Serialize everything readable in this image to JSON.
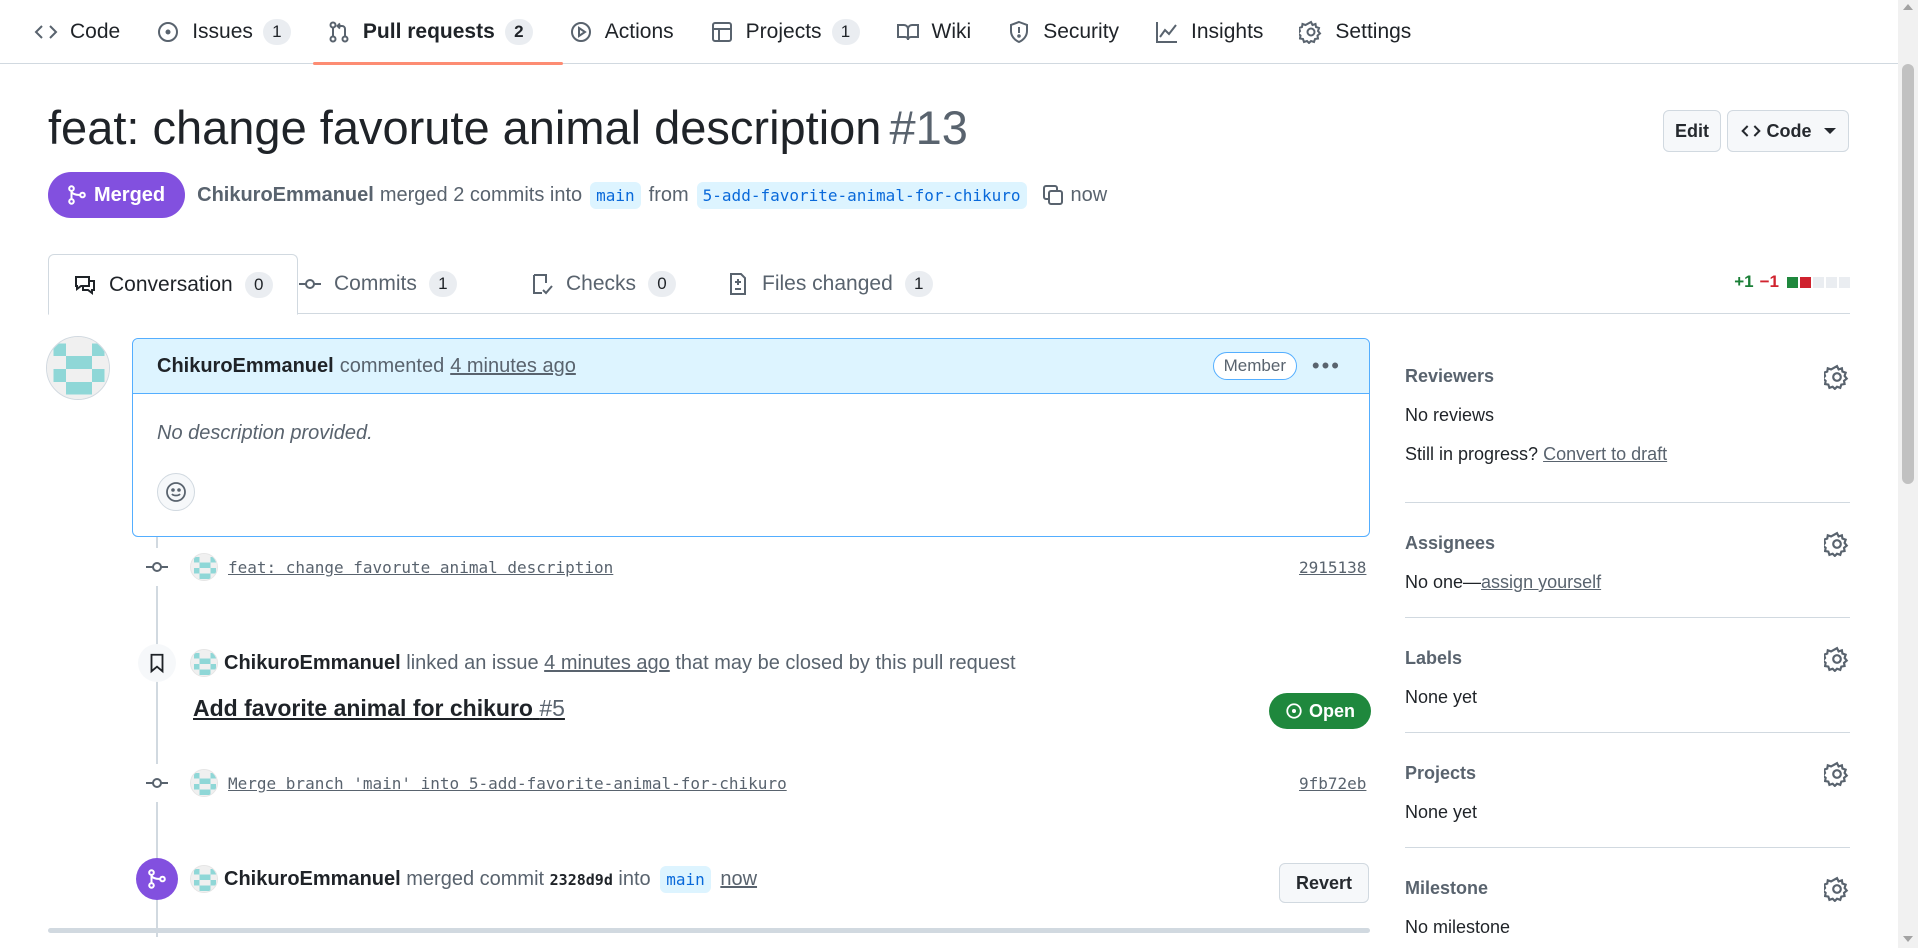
{
  "repo_nav": {
    "items": [
      {
        "label": "Code",
        "count": null
      },
      {
        "label": "Issues",
        "count": "1"
      },
      {
        "label": "Pull requests",
        "count": "2"
      },
      {
        "label": "Actions",
        "count": null
      },
      {
        "label": "Projects",
        "count": "1"
      },
      {
        "label": "Wiki",
        "count": null
      },
      {
        "label": "Security",
        "count": null
      },
      {
        "label": "Insights",
        "count": null
      },
      {
        "label": "Settings",
        "count": null
      }
    ],
    "selected": "Pull requests"
  },
  "pr": {
    "title": "feat: change favorute animal description",
    "number": "#13",
    "edit_label": "Edit",
    "code_label": "Code",
    "state": "Merged",
    "author": "ChikuroEmmanuel",
    "summary_merged": "merged 2 commits into",
    "base_branch": "main",
    "from_label": "from",
    "head_branch": "5-add-favorite-animal-for-chikuro",
    "time": "now"
  },
  "tabs": [
    {
      "label": "Conversation",
      "count": "0"
    },
    {
      "label": "Commits",
      "count": "1"
    },
    {
      "label": "Checks",
      "count": "0"
    },
    {
      "label": "Files changed",
      "count": "1"
    }
  ],
  "diffstat": {
    "additions": "+1",
    "deletions": "−1"
  },
  "comment": {
    "author": "ChikuroEmmanuel",
    "action": "commented",
    "time": "4 minutes ago",
    "role": "Member",
    "body": "No description provided."
  },
  "timeline": {
    "commit1": {
      "message": "feat: change favorute animal description",
      "sha": "2915138"
    },
    "linked": {
      "author": "ChikuroEmmanuel",
      "action": "linked an issue",
      "time": "4 minutes ago",
      "suffix": "that may be closed by this pull request",
      "issue_title": "Add favorite animal for chikuro",
      "issue_number": "#5",
      "issue_state": "Open"
    },
    "commit2": {
      "message": "Merge branch 'main' into 5-add-favorite-animal-for-chikuro",
      "sha": "9fb72eb"
    },
    "merged": {
      "author": "ChikuroEmmanuel",
      "action": "merged commit",
      "sha": "2328d9d",
      "into": "into",
      "branch": "main",
      "time": "now",
      "revert_label": "Revert"
    }
  },
  "sidebar": {
    "reviewers": {
      "title": "Reviewers",
      "value": "No reviews",
      "progress_label": "Still in progress?",
      "draft_link": "Convert to draft"
    },
    "assignees": {
      "title": "Assignees",
      "value": "No one—",
      "assign_link": "assign yourself"
    },
    "labels": {
      "title": "Labels",
      "value": "None yet"
    },
    "projects": {
      "title": "Projects",
      "value": "None yet"
    },
    "milestone": {
      "title": "Milestone",
      "value": "No milestone"
    }
  },
  "colors": {
    "merged": "#8250df",
    "open": "#1f883d",
    "accent_underline": "#fd8c73",
    "link_blue": "#0969da"
  }
}
